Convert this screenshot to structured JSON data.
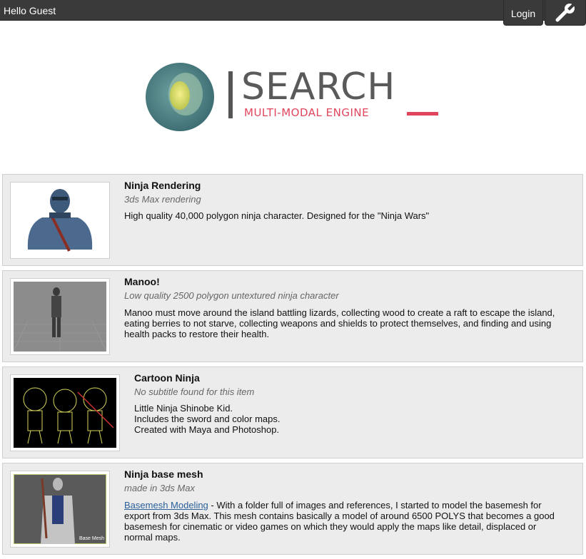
{
  "topbar": {
    "greeting": "Hello Guest",
    "login_label": "Login",
    "settings_icon": "wrench-icon"
  },
  "logo": {
    "word": "SEARCH",
    "subtitle": "MULTI-MODAL ENGINE",
    "accent_color": "#e0455d"
  },
  "results": [
    {
      "title": "Ninja Rendering",
      "subtitle": "3ds Max rendering",
      "description": "High quality 40,000 polygon ninja character. Designed for the \"Ninja Wars\""
    },
    {
      "title": "Manoo!",
      "subtitle": "Low quality 2500 polygon untextured ninja character",
      "description": "Manoo must move around the island battling lizards, collecting wood to create a raft to escape the island,\neating berries to not starve, collecting weapons and shields to protect themselves, and finding and using\nhealth packs to restore their health."
    },
    {
      "title": "Cartoon Ninja",
      "subtitle": "No subtitle found for this item",
      "description": "Little Ninja Shinobe Kid.\nIncludes the sword and color maps.\nCreated with Maya and Photoshop."
    },
    {
      "title": "Ninja base mesh",
      "subtitle": "made in 3ds Max",
      "link_text": "Basemesh Modeling",
      "description": " - With a folder full of images and references, I started to model the basemesh for\nexport from 3ds Max. This mesh contains basically a model of around 6500 POLYS that becomes a good\nbasemesh for cinematic or video games on which they would apply the maps like detail, displaced or\nnormal maps.",
      "thumb_caption": "Base Mesh"
    }
  ]
}
